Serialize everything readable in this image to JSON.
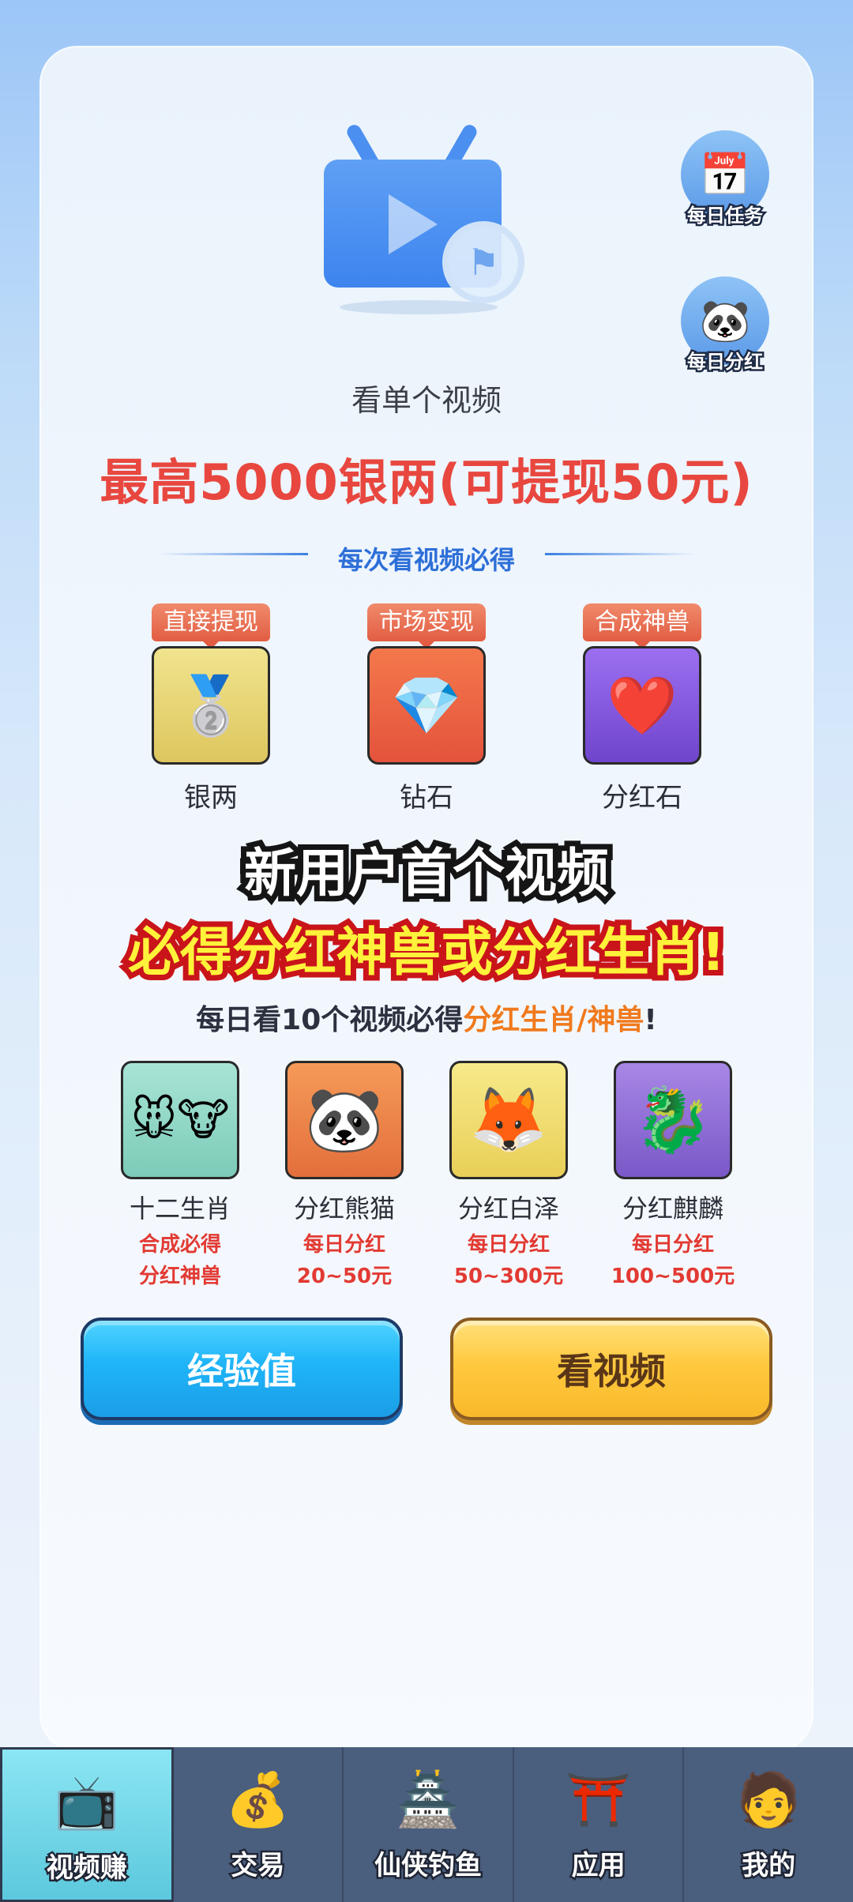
{
  "side_buttons": {
    "daily_task": {
      "label": "每日任务",
      "icon": "calendar-icon"
    },
    "daily_dividend": {
      "label": "每日分红",
      "icon": "panda-icon"
    }
  },
  "hero": {
    "subtitle": "看单个视频",
    "headline": "最高5000银两(可提现50元)",
    "divider_text": "每次看视频必得"
  },
  "rewards": [
    {
      "tag": "直接提现",
      "name": "银两",
      "icon": "silver-ingot-icon",
      "bg": "#e8d77a"
    },
    {
      "tag": "市场变现",
      "name": "钻石",
      "icon": "diamond-icon",
      "bg": "#ee6a47"
    },
    {
      "tag": "合成神兽",
      "name": "分红石",
      "icon": "ruby-icon",
      "bg": "#8a5ee0"
    }
  ],
  "promo": {
    "line1": "新用户首个视频",
    "line2": "必得分红神兽或分红生肖!"
  },
  "daily": {
    "prefix": "每日看10个视频必得",
    "highlight": "分红生肖/神兽",
    "suffix": "!"
  },
  "beasts": [
    {
      "name": "十二生肖",
      "desc1": "合成必得",
      "desc2": "分红神兽",
      "icon": "zodiac-icon",
      "bg": "#8fd8c8"
    },
    {
      "name": "分红熊猫",
      "desc1": "每日分红",
      "desc2": "20~50元",
      "icon": "panda-icon",
      "bg": "#f08a4b"
    },
    {
      "name": "分红白泽",
      "desc1": "每日分红",
      "desc2": "50~300元",
      "icon": "baize-icon",
      "bg": "#f3e178"
    },
    {
      "name": "分红麒麟",
      "desc1": "每日分红",
      "desc2": "100~500元",
      "icon": "qilin-icon",
      "bg": "#9a7ad8"
    }
  ],
  "buttons": {
    "experience": "经验值",
    "watch_video": "看视频"
  },
  "tabs": [
    {
      "label": "视频赚",
      "icon": "video-tv-icon",
      "active": true
    },
    {
      "label": "交易",
      "icon": "money-bag-icon",
      "active": false
    },
    {
      "label": "仙侠钓鱼",
      "icon": "pavilion-icon",
      "active": false
    },
    {
      "label": "应用",
      "icon": "portal-gate-icon",
      "active": false
    },
    {
      "label": "我的",
      "icon": "avatar-icon",
      "active": false
    }
  ],
  "colors": {
    "headline": "#e8473f",
    "divider": "#3b7fe0",
    "highlight": "#f07a1e",
    "tabbar": "#4a5e7e",
    "tab_active": "#6fd6e8"
  }
}
